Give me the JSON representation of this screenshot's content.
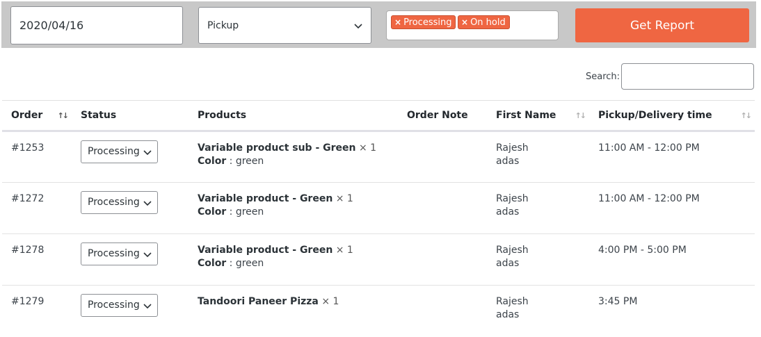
{
  "filters": {
    "date_value": "2020/04/16",
    "type_selected": "Pickup",
    "status_chips": [
      "Processing",
      "On hold"
    ],
    "chip_remove": "×",
    "report_button": "Get Report"
  },
  "search": {
    "label": "Search:",
    "value": ""
  },
  "table": {
    "columns": {
      "order": "Order",
      "status": "Status",
      "products": "Products",
      "order_note": "Order Note",
      "first_name": "First Name",
      "pickup_time": "Pickup/Delivery time"
    },
    "sort_glyph": "↑↓",
    "rows": [
      {
        "order": "#1253",
        "status": "Processing",
        "product": "Variable product sub - Green",
        "qty": "× 1",
        "attr_label": "Color",
        "attr_sep": " : ",
        "attr_value": "green",
        "note": "",
        "first_name": "Rajesh",
        "last_name": "adas",
        "time": "11:00 AM - 12:00 PM"
      },
      {
        "order": "#1272",
        "status": "Processing",
        "product": "Variable product - Green",
        "qty": "× 1",
        "attr_label": "Color",
        "attr_sep": " : ",
        "attr_value": "green",
        "note": "",
        "first_name": "Rajesh",
        "last_name": "adas",
        "time": "11:00 AM - 12:00 PM"
      },
      {
        "order": "#1278",
        "status": "Processing",
        "product": "Variable product - Green",
        "qty": "× 1",
        "attr_label": "Color",
        "attr_sep": " : ",
        "attr_value": "green",
        "note": "",
        "first_name": "Rajesh",
        "last_name": "adas",
        "time": "4:00 PM - 5:00 PM"
      },
      {
        "order": "#1279",
        "status": "Processing",
        "product": "Tandoori Paneer Pizza",
        "qty": "× 1",
        "attr_label": "",
        "attr_sep": "",
        "attr_value": "",
        "note": "",
        "first_name": "Rajesh",
        "last_name": "adas",
        "time": "3:45 PM"
      }
    ]
  },
  "colors": {
    "accent": "#ef6642",
    "filter_bar": "#c8c8c8"
  }
}
